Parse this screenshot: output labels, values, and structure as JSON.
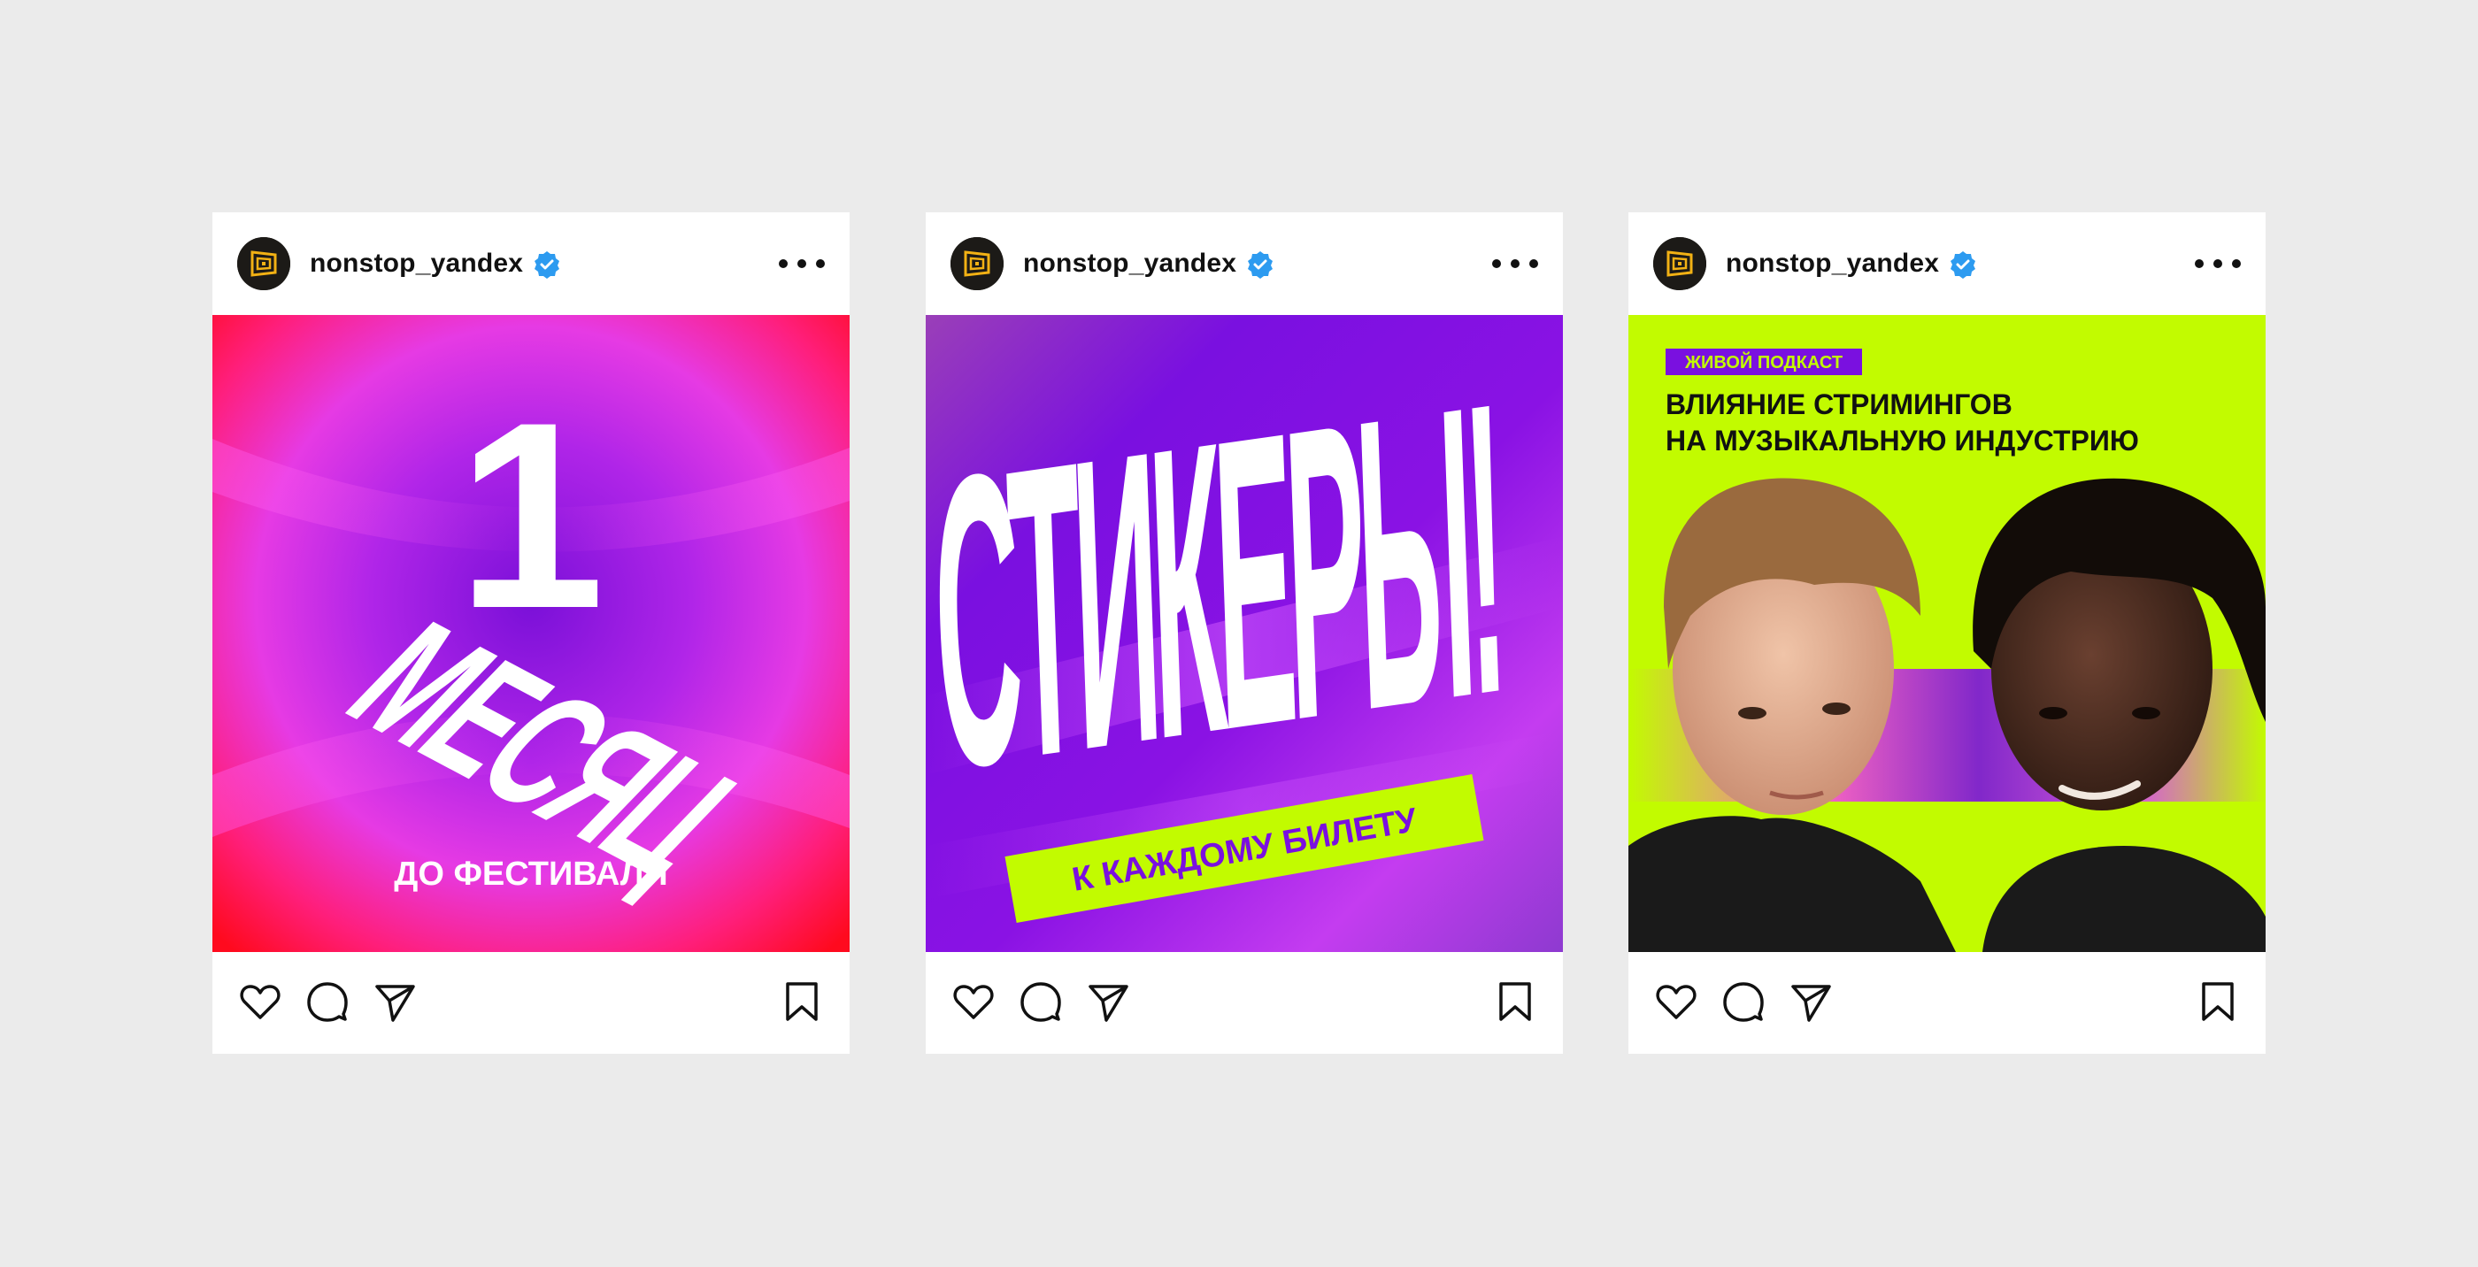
{
  "posts": [
    {
      "username": "nonstop_yandex",
      "headline_number": "1",
      "headline_word": "МЕСЯЦ",
      "caption": "ДО ФЕСТИВАЛЯ"
    },
    {
      "username": "nonstop_yandex",
      "headline_word": "СТИКЕРЫ!",
      "tag": "К КАЖДОМУ БИЛЕТУ"
    },
    {
      "username": "nonstop_yandex",
      "badge": "ЖИВОЙ ПОДКАСТ",
      "title_line1": "ВЛИЯНИЕ СТРИМИНГОВ",
      "title_line2": "НА МУЗЫКАЛЬНУЮ ИНДУСТРИЮ"
    }
  ],
  "icons": {
    "more": "more-options-icon",
    "verified": "verified-badge-icon",
    "like": "heart-icon",
    "comment": "comment-icon",
    "share": "send-icon",
    "save": "bookmark-icon"
  },
  "colors": {
    "background": "#ebebeb",
    "verified_blue": "#2d9bf0",
    "accent_lime": "#c2fb00",
    "accent_purple": "#7a10e0",
    "accent_red": "#ff0a1e",
    "accent_pink": "#e93ae6"
  }
}
